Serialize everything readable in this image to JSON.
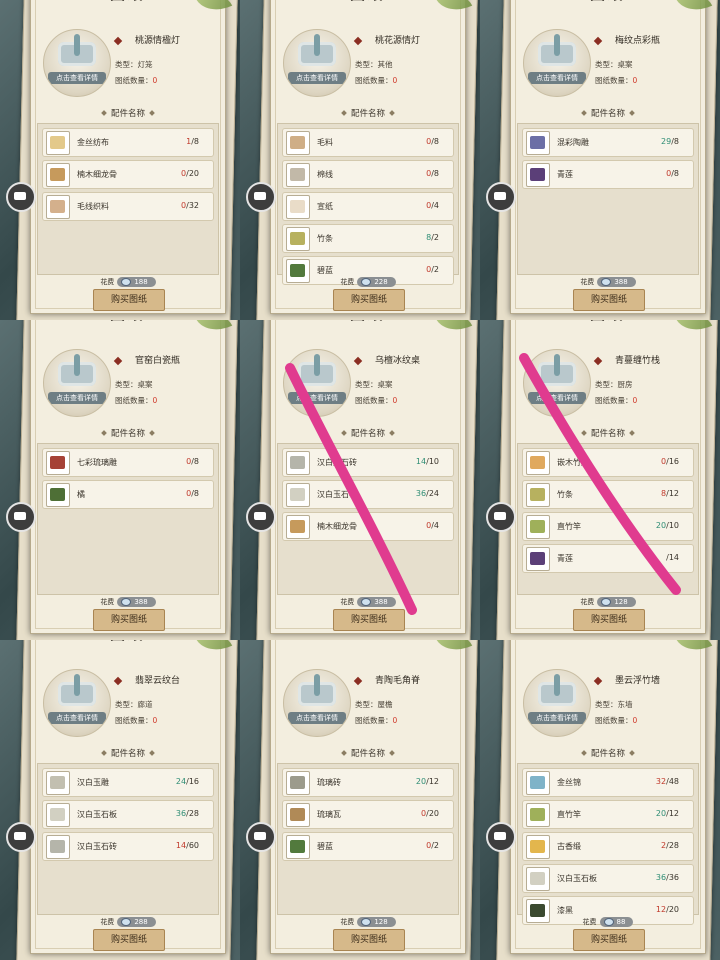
{
  "header_label": "图纸",
  "detail_button_label": "点击查看详情",
  "type_label": "类型：",
  "count_label": "图纸数量：",
  "parts_heading": "配件名称",
  "cost_label": "花费",
  "buy_button_label": "购买图纸",
  "panels": [
    {
      "title": "桃源情楹灯",
      "type": "灯笼",
      "count": "0",
      "cost": "188",
      "parts": [
        {
          "name": "金丝纺布",
          "have": "1",
          "need": "8",
          "color": "#e3c98a"
        },
        {
          "name": "楠木细龙骨",
          "have": "0",
          "need": "20",
          "color": "#c69a5c"
        },
        {
          "name": "毛线织料",
          "have": "0",
          "need": "32",
          "color": "#d4b08c"
        }
      ]
    },
    {
      "title": "桃花源情灯",
      "type": "其他",
      "count": "0",
      "cost": "228",
      "parts": [
        {
          "name": "毛料",
          "have": "0",
          "need": "8",
          "color": "#cfae86"
        },
        {
          "name": "棉线",
          "have": "0",
          "need": "8",
          "color": "#c2b9a8"
        },
        {
          "name": "宣纸",
          "have": "0",
          "need": "4",
          "color": "#e9dcc8"
        },
        {
          "name": "竹条",
          "have": "8",
          "need": "2",
          "color": "#b7b15f"
        },
        {
          "name": "碧蓝",
          "have": "0",
          "need": "2",
          "color": "#527a3d"
        }
      ]
    },
    {
      "title": "梅纹点彩瓶",
      "type": "桌案",
      "count": "0",
      "cost": "388",
      "parts": [
        {
          "name": "混彩陶雕",
          "have": "29",
          "need": "8",
          "color": "#6c6fa6"
        },
        {
          "name": "青莲",
          "have": "0",
          "need": "8",
          "color": "#5b3f78"
        }
      ]
    },
    {
      "title": "官窑白瓷瓶",
      "type": "桌案",
      "count": "0",
      "cost": "388",
      "parts": [
        {
          "name": "七彩琉璃雕",
          "have": "0",
          "need": "8",
          "color": "#a64236"
        },
        {
          "name": "橘",
          "have": "0",
          "need": "8",
          "color": "#4e6f36"
        }
      ]
    },
    {
      "title": "乌檀冰纹桌",
      "type": "桌案",
      "count": "0",
      "cost": "388",
      "crossed": true,
      "parts": [
        {
          "name": "汉白玉石砖",
          "have": "14",
          "need": "10",
          "color": "#b5b5aa"
        },
        {
          "name": "汉白玉石板",
          "have": "36",
          "need": "24",
          "color": "#d2d0c2"
        },
        {
          "name": "楠木细龙骨",
          "have": "0",
          "need": "4",
          "color": "#c69a5c"
        }
      ]
    },
    {
      "title": "青蔓缠竹栈",
      "type": "厨房",
      "count": "0",
      "cost": "128",
      "crossed": true,
      "parts": [
        {
          "name": "嵌木竹雕",
          "have": "0",
          "need": "16",
          "color": "#e0a95e"
        },
        {
          "name": "竹条",
          "have": "8",
          "need": "12",
          "color": "#b7b15f"
        },
        {
          "name": "直竹竿",
          "have": "20",
          "need": "10",
          "color": "#9fb05a"
        },
        {
          "name": "青莲",
          "have": "",
          "need": "14",
          "color": "#5b3f78"
        }
      ]
    },
    {
      "title": "翡翠云纹台",
      "type": "廊道",
      "count": "0",
      "cost": "288",
      "parts": [
        {
          "name": "汉白玉雕",
          "have": "24",
          "need": "16",
          "color": "#c2bfb0"
        },
        {
          "name": "汉白玉石板",
          "have": "36",
          "need": "28",
          "color": "#d2d0c2"
        },
        {
          "name": "汉白玉石砖",
          "have": "14",
          "need": "60",
          "color": "#b5b5aa"
        }
      ]
    },
    {
      "title": "青陶毛角脊",
      "type": "屋檐",
      "count": "0",
      "cost": "128",
      "parts": [
        {
          "name": "琉璃砖",
          "have": "20",
          "need": "12",
          "color": "#9c9b8c"
        },
        {
          "name": "琉璃瓦",
          "have": "0",
          "need": "20",
          "color": "#b08a57"
        },
        {
          "name": "碧蓝",
          "have": "0",
          "need": "2",
          "color": "#527a3d"
        }
      ]
    },
    {
      "title": "墨云浮竹墙",
      "type": "东墙",
      "count": "0",
      "cost": "88",
      "parts": [
        {
          "name": "金丝锦",
          "have": "32",
          "need": "48",
          "color": "#7fb3c8"
        },
        {
          "name": "直竹竿",
          "have": "20",
          "need": "12",
          "color": "#9fb05a"
        },
        {
          "name": "古香缎",
          "have": "2",
          "need": "28",
          "color": "#e3b64d"
        },
        {
          "name": "汉白玉石板",
          "have": "36",
          "need": "36",
          "color": "#d2d0c2"
        },
        {
          "name": "漆黑",
          "have": "12",
          "need": "20",
          "color": "#3b4a30"
        }
      ]
    }
  ]
}
